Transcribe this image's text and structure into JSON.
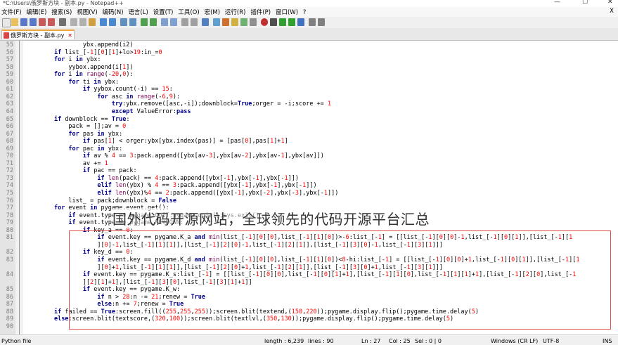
{
  "window": {
    "title": "*C:\\Users\\俄罗斯方块 - 副本.py - Notepad++",
    "minimize": "—",
    "maximize": "☐",
    "close": "✕"
  },
  "menu": [
    "文件(F)",
    "编辑(E)",
    "搜索(S)",
    "视图(V)",
    "编码(N)",
    "语言(L)",
    "设置(T)",
    "工具(O)",
    "宏(M)",
    "运行(R)",
    "插件(P)",
    "窗口(W)",
    "?"
  ],
  "menu_close": "X",
  "tab": {
    "label": "俄罗斯方块 - 副本.py",
    "close": "✕"
  },
  "lines": [
    {
      "n": "55",
      "code": "                ybx.append(i2)"
    },
    {
      "n": "56",
      "code": "        if list_[-1][0][1]+lo>19:in_=0"
    },
    {
      "n": "57",
      "code": "        for i in ybx:"
    },
    {
      "n": "58",
      "code": "            yybox.append(i[1])"
    },
    {
      "n": "59",
      "code": "        for i in range(-20,0):"
    },
    {
      "n": "60",
      "code": "            for ti in ybx:"
    },
    {
      "n": "61",
      "code": "                if yybox.count(-i) == 15:"
    },
    {
      "n": "62",
      "code": "                    for asc in range(-6,9):"
    },
    {
      "n": "63",
      "code": "                        try:ybx.remove([asc,-i]);downblock=True;orger = -i;score += 1"
    },
    {
      "n": "64",
      "code": "                        except ValueError:pass"
    },
    {
      "n": "65",
      "code": "        if downblock == True:"
    },
    {
      "n": "66",
      "code": "            pack = [];av = 0"
    },
    {
      "n": "67",
      "code": "            for pas in ybx:"
    },
    {
      "n": "68",
      "code": "                if pas[1] < orger:ybx[ybx.index(pas)] = [pas[0],pas[1]+1]"
    },
    {
      "n": "69",
      "code": "            for pac in ybx:"
    },
    {
      "n": "70",
      "code": "                if av % 4 == 3:pack.append([ybx[av-3],ybx[av-2],ybx[av-1],ybx[av]])"
    },
    {
      "n": "71",
      "code": "                av += 1"
    },
    {
      "n": "72",
      "code": "                if pac == pack:"
    },
    {
      "n": "73",
      "code": "                    if len(pack) == 4:pack.append([ybx[-1],ybx[-1],ybx[-1]])"
    },
    {
      "n": "74",
      "code": "                    elif len(ybx) % 4 == 3:pack.append([ybx[-1],ybx[-1],ybx[-1]])"
    },
    {
      "n": "75",
      "code": "                    elif len(ybx)%4 == 2:pack.append([ybx[-1],ybx[-2],ybx[-3],ybx[-1]])"
    },
    {
      "n": "76",
      "code": "            list_ = pack;downblock = False"
    },
    {
      "n": "77",
      "code": "        for event in pygame.event.get():"
    },
    {
      "n": "78",
      "code": "            if event.type == pygame.QUIT:pygame.quit();sys.exit()"
    },
    {
      "n": "79",
      "code": "            if event.type == pygame.KEYDOWN:"
    },
    {
      "n": "80",
      "code": "                if key_a == 0:"
    },
    {
      "n": "81",
      "code": "                    if event.key == pygame.K_a and min(list_[-1][0][0],list_[-1][1][0])>-6:list_[-1] = [[list_[-1][0][0]-1,list_[-1][0][1]],[list_[-1][1"
    },
    {
      "n": "",
      "code": "                    ][0]-1,list_[-1][1][1]],[list_[-1][2][0]-1,list_[-1][2][1]],[list_[-1][3][0]-1,list_[-1][3][1]]]"
    },
    {
      "n": "82",
      "code": "                if key_d == 0:"
    },
    {
      "n": "83",
      "code": "                    if event.key == pygame.K_d and min(list_[-1][0][0],list_[-1][1][0])<8-hi:list_[-1] = [[list_[-1][0][0]+1,list_[-1][0][1]],[list_[-1][1"
    },
    {
      "n": "",
      "code": "                    ][0]+1,list_[-1][1][1]],[list_[-1][2][0]+1,list_[-1][2][1]],[list_[-1][3][0]+1,list_[-1][3][1]]]"
    },
    {
      "n": "84",
      "code": "                if event.key == pygame.K_s:list_[-1] = [[list_[-1][0][0],list_[-1][0][1]+1],[list_[-1][1][0],list_[-1][1][1]+1],[list_[-1][2][0],list_[-1"
    },
    {
      "n": "",
      "code": "                ][2][1]+1],[list_[-1][3][0],list_[-1][3][1]+1]]"
    },
    {
      "n": "85",
      "code": "                if event.key == pygame.K_w:"
    },
    {
      "n": "86",
      "code": "                    if n > 28:n -= 21;renew = True"
    },
    {
      "n": "87",
      "code": "                    else:n += 7;renew = True"
    },
    {
      "n": "88",
      "code": "        if failed == True:screen.fill((255,255,255));screen.blit(textend,(150,220));pygame.display.flip();pygame.time.delay(5)"
    },
    {
      "n": "89",
      "code": "        else:screen.blit(textscore,(320,100));screen.blit(textlvl,(350,130));pygame.display.flip();pygame.time.delay(5)"
    },
    {
      "n": "90",
      "code": ""
    }
  ],
  "watermark": "国外代码开源网站，全球领先的代码开源平台汇总",
  "status": {
    "lang": "Python file",
    "length": "length : 6,239",
    "lines": "lines : 90",
    "ln": "Ln : 27",
    "col": "Col : 25",
    "sel": "Sel : 0 | 0",
    "eol": "Windows (CR LF)",
    "enc": "UTF-8",
    "ins": "INS"
  }
}
